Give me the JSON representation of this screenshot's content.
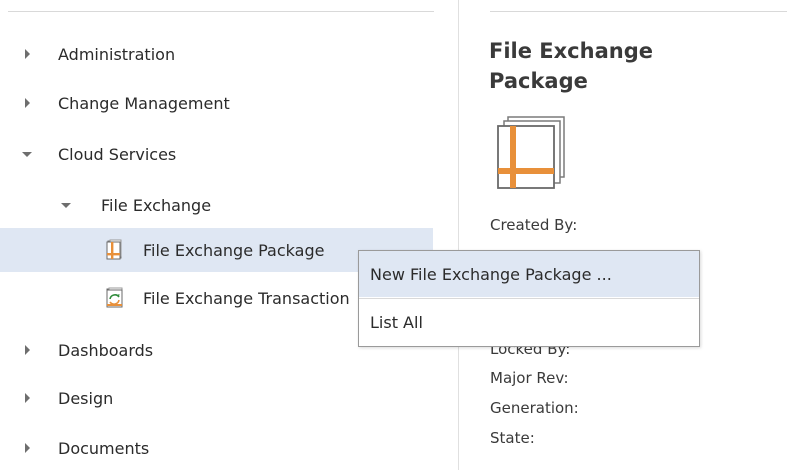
{
  "tree": {
    "items": [
      {
        "label": "Administration"
      },
      {
        "label": "Change Management"
      },
      {
        "label": "Cloud Services"
      },
      {
        "label": "File Exchange"
      },
      {
        "label": "File Exchange Package"
      },
      {
        "label": "File Exchange Transaction"
      },
      {
        "label": "Dashboards"
      },
      {
        "label": "Design"
      },
      {
        "label": "Documents"
      }
    ],
    "selected_label": "File Exchange Package"
  },
  "details": {
    "title": "File Exchange Package",
    "fields": {
      "created_by": "Created By:",
      "locked_by": "Locked By:",
      "major_rev": "Major Rev:",
      "generation": "Generation:",
      "state": "State:"
    }
  },
  "context_menu": {
    "items": [
      {
        "label": "New File Exchange Package ..."
      },
      {
        "label": "List All"
      }
    ]
  },
  "colors": {
    "selection": "#dfe7f3",
    "icon_orange": "#e8903a",
    "border": "#9a9a9a"
  }
}
